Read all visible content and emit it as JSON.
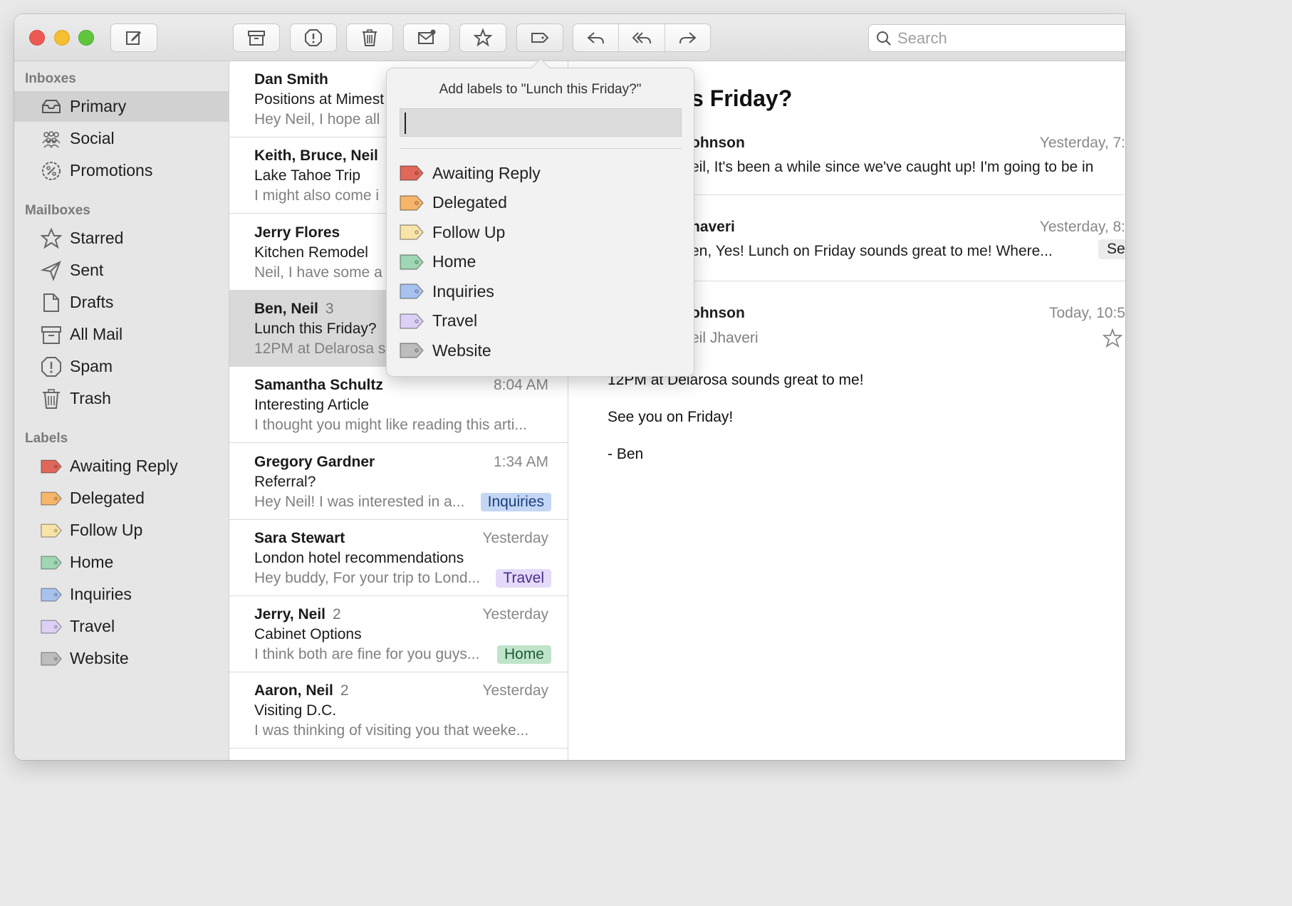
{
  "toolbar": {
    "search_placeholder": "Search"
  },
  "sidebar": {
    "inboxes_title": "Inboxes",
    "mailboxes_title": "Mailboxes",
    "labels_title": "Labels",
    "inboxes": [
      {
        "label": "Primary",
        "icon": "inbox-icon"
      },
      {
        "label": "Social",
        "icon": "people-icon"
      },
      {
        "label": "Promotions",
        "icon": "percent-badge-icon"
      }
    ],
    "mailboxes": [
      {
        "label": "Starred",
        "icon": "star-icon"
      },
      {
        "label": "Sent",
        "icon": "paper-plane-icon"
      },
      {
        "label": "Drafts",
        "icon": "draft-icon"
      },
      {
        "label": "All Mail",
        "icon": "archive-icon"
      },
      {
        "label": "Spam",
        "icon": "spam-icon"
      },
      {
        "label": "Trash",
        "icon": "trash-icon"
      }
    ],
    "labels": [
      {
        "label": "Awaiting Reply",
        "color": "#e0685a"
      },
      {
        "label": "Delegated",
        "color": "#f5b56a"
      },
      {
        "label": "Follow Up",
        "color": "#f8e3a8"
      },
      {
        "label": "Home",
        "color": "#9fd6b3"
      },
      {
        "label": "Inquiries",
        "color": "#a8c2ee"
      },
      {
        "label": "Travel",
        "color": "#dcd0f7"
      },
      {
        "label": "Website",
        "color": "#bdbdbd"
      }
    ]
  },
  "maillist": [
    {
      "from": "Dan Smith",
      "count": "",
      "time": "",
      "subject": "Positions at Mimest",
      "preview": "Hey Neil, I hope all",
      "tag": ""
    },
    {
      "from": "Keith, Bruce, Neil",
      "count": "",
      "time": "",
      "subject": "Lake Tahoe Trip",
      "preview": "I might also come i",
      "tag": ""
    },
    {
      "from": "Jerry Flores",
      "count": "",
      "time": "",
      "subject": "Kitchen Remodel",
      "preview": "Neil, I have some a",
      "tag": ""
    },
    {
      "from": "Ben, Neil",
      "count": "3",
      "time": "",
      "subject": "Lunch this Friday?",
      "preview": "12PM at Delarosa s",
      "tag": ""
    },
    {
      "from": "Samantha Schultz",
      "count": "",
      "time": "8:04 AM",
      "subject": "Interesting Article",
      "preview": "I thought you might like reading this arti...",
      "tag": ""
    },
    {
      "from": "Gregory Gardner",
      "count": "",
      "time": "1:34 AM",
      "subject": "Referral?",
      "preview": "Hey Neil! I was interested in a...",
      "tag": "Inquiries"
    },
    {
      "from": "Sara Stewart",
      "count": "",
      "time": "Yesterday",
      "subject": "London hotel recommendations",
      "preview": "Hey buddy, For your trip to Lond...",
      "tag": "Travel"
    },
    {
      "from": "Jerry, Neil",
      "count": "2",
      "time": "Yesterday",
      "subject": "Cabinet Options",
      "preview": "I think both are fine for you guys...",
      "tag": "Home"
    },
    {
      "from": "Aaron, Neil",
      "count": "2",
      "time": "Yesterday",
      "subject": "Visiting D.C.",
      "preview": "I was thinking of visiting you that weeke...",
      "tag": ""
    }
  ],
  "reading": {
    "title": "s Friday?",
    "messages": [
      {
        "name": "ohnson",
        "time": "Yesterday, 7:",
        "snippet": "eil, It's been a while since we've caught up! I'm going to be in"
      },
      {
        "name": "haveri",
        "time": "Yesterday, 8:",
        "snippet": "en, Yes! Lunch on Friday sounds great to me! Where...",
        "chip": "Sen"
      },
      {
        "name": "ohnson",
        "time": "Today, 10:5",
        "sub": "eil Jhaveri"
      }
    ],
    "body": [
      "12PM at Delarosa sounds great to me!",
      "See you on Friday!",
      "- Ben"
    ]
  },
  "popover": {
    "title": "Add labels to \"Lunch this Friday?\"",
    "input_value": "",
    "items": [
      {
        "label": "Awaiting Reply",
        "color": "#e0685a"
      },
      {
        "label": "Delegated",
        "color": "#f5b56a"
      },
      {
        "label": "Follow Up",
        "color": "#f8e3a8"
      },
      {
        "label": "Home",
        "color": "#9fd6b3"
      },
      {
        "label": "Inquiries",
        "color": "#a8c2ee"
      },
      {
        "label": "Travel",
        "color": "#dcd0f7"
      },
      {
        "label": "Website",
        "color": "#bdbdbd"
      }
    ]
  },
  "tag_colors": {
    "Inquiries": {
      "bg": "#c3d6f4",
      "fg": "#1c3f7a"
    },
    "Travel": {
      "bg": "#e3dbf9",
      "fg": "#4b2c8a"
    },
    "Home": {
      "bg": "#bfe4ca",
      "fg": "#1d5a33"
    }
  }
}
